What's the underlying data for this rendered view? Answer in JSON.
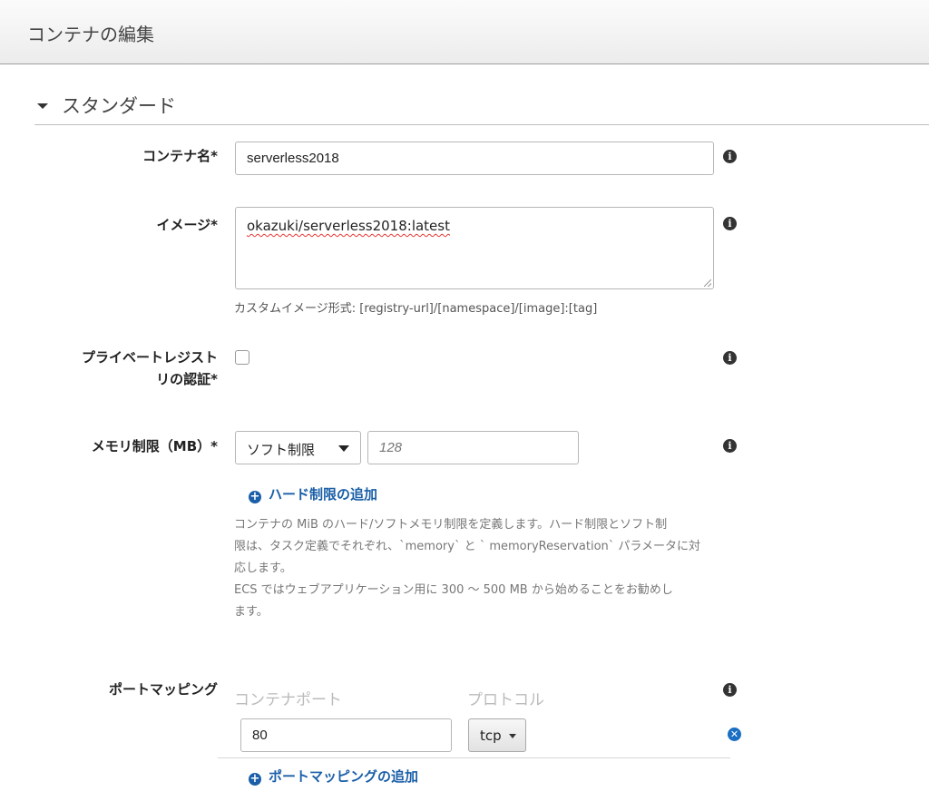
{
  "header": {
    "title": "コンテナの編集"
  },
  "section": {
    "title": "スタンダード"
  },
  "container_name": {
    "label": "コンテナ名*",
    "value": "serverless2018"
  },
  "image": {
    "label": "イメージ*",
    "value": "okazuki/serverless2018:latest",
    "hint": "カスタムイメージ形式: [registry-url]/[namespace]/[image]:[tag]"
  },
  "private_registry": {
    "label_line1": "プライベートレジスト",
    "label_line2": "リの認証*",
    "checked": false
  },
  "memory": {
    "label": "メモリ制限（MB）*",
    "select_value": "ソフト制限",
    "placeholder": "128",
    "add_hard_limit": "ハード制限の追加",
    "help_lines": [
      "コンテナの MiB のハード/ソフトメモリ制限を定義します。ハード制限とソフト制",
      "限は、タスク定義でそれぞれ、`memory` と ` memoryReservation` パラメータに対",
      "応します。",
      "ECS ではウェブアプリケーション用に 300 ～ 500 MB から始めることをお勧めし",
      "ます。"
    ]
  },
  "port_mapping": {
    "label": "ポートマッピング",
    "col_container_port": "コンテナポート",
    "col_protocol": "プロトコル",
    "rows": [
      {
        "port": "80",
        "protocol": "tcp"
      }
    ],
    "add_label": "ポートマッピングの追加"
  },
  "icons": {
    "info": "info-icon",
    "plus": "plus-circle-icon",
    "remove": "remove-circle-icon",
    "caret": "caret-down-icon"
  }
}
